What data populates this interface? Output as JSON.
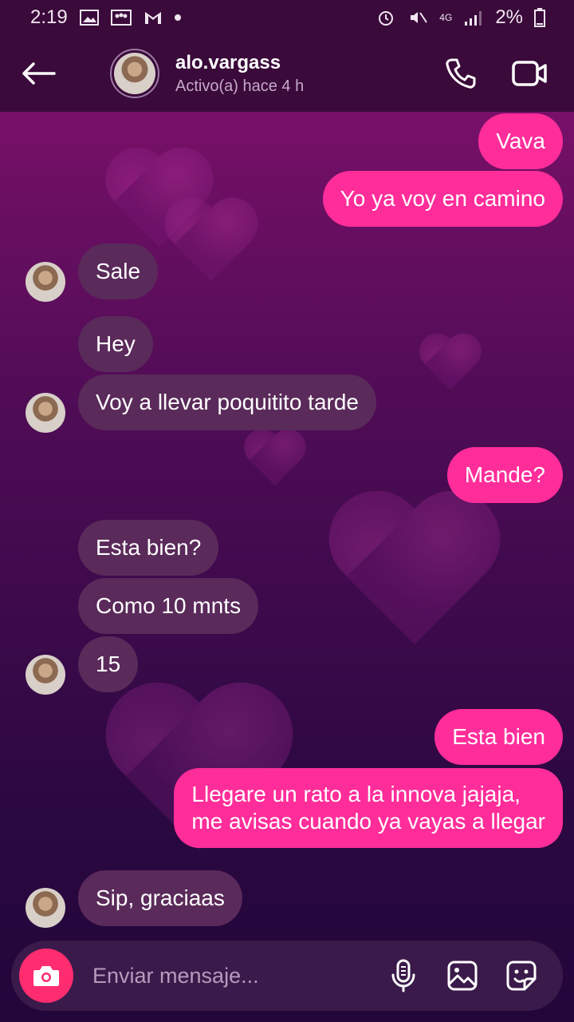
{
  "status_bar": {
    "time": "2:19",
    "battery": "2%",
    "network": "4G"
  },
  "header": {
    "contact_name": "alo.vargass",
    "contact_status": "Activo(a) hace 4 h"
  },
  "messages": [
    {
      "text": "Vava",
      "direction": "out"
    },
    {
      "text": "Yo ya voy en camino",
      "direction": "out"
    },
    {
      "text": "Sale",
      "direction": "in"
    },
    {
      "text": "Hey",
      "direction": "in"
    },
    {
      "text": "Voy a llevar poquitito tarde",
      "direction": "in"
    },
    {
      "text": "Mande?",
      "direction": "out"
    },
    {
      "text": "Esta bien?",
      "direction": "in"
    },
    {
      "text": "Como 10 mnts",
      "direction": "in"
    },
    {
      "text": "15",
      "direction": "in"
    },
    {
      "text": "Esta bien",
      "direction": "out"
    },
    {
      "text": "Llegare un rato a la innova jajaja,",
      "direction": "out"
    },
    {
      "text": "me avisas cuando ya vayas a llegar",
      "direction": "out"
    },
    {
      "text": "Sip, graciaas",
      "direction": "in"
    }
  ],
  "composer": {
    "placeholder": "Enviar mensaje..."
  },
  "colors": {
    "outgoing_bubble": "#ff2d9a",
    "incoming_bubble": "#5a2a5a",
    "camera_button": "#ff2d6f"
  }
}
